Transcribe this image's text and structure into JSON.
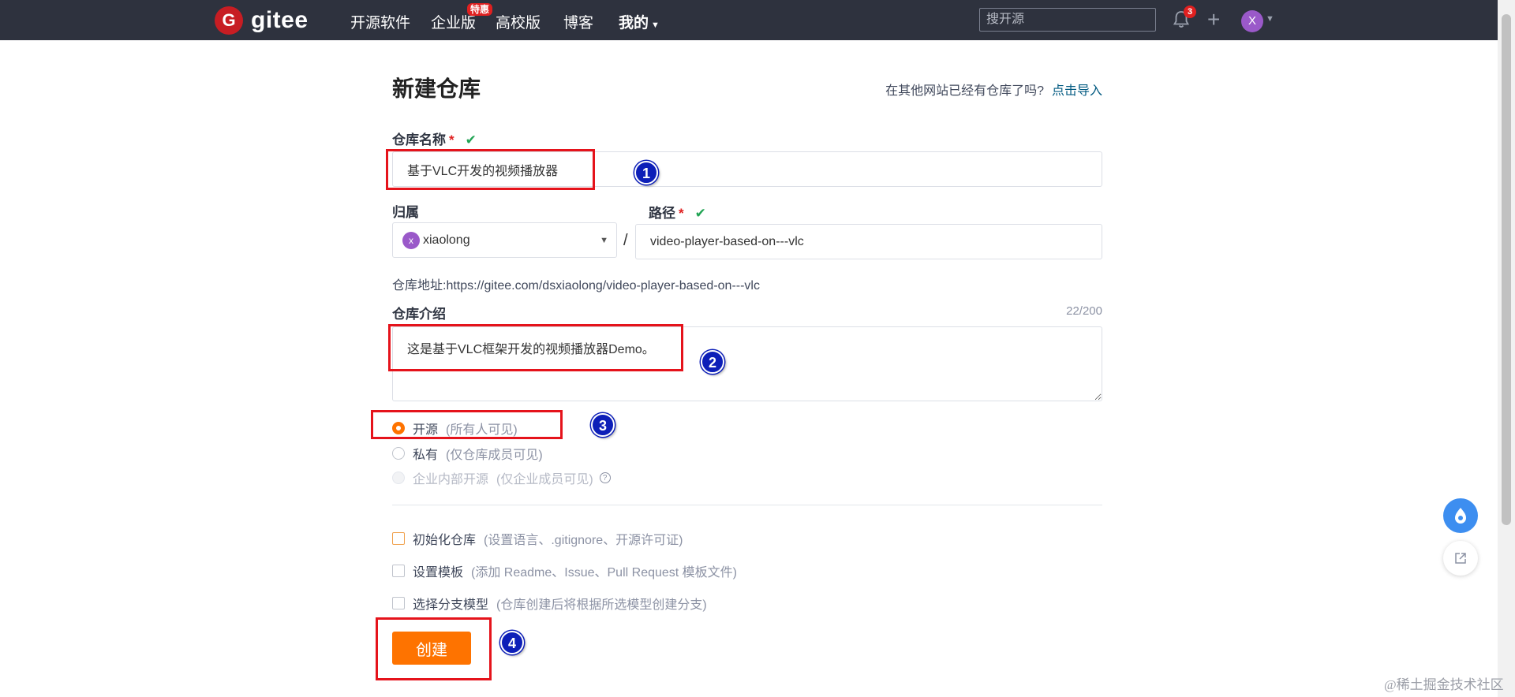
{
  "nav": {
    "logo_mark": "G",
    "logo_text": "gitee",
    "items": [
      "开源软件",
      "企业版",
      "高校版",
      "博客",
      "我的"
    ],
    "enterprise_badge": "特惠",
    "search_placeholder": "搜开源",
    "notification_count": "3",
    "avatar_letter": "X"
  },
  "form": {
    "title": "新建仓库",
    "import_prompt": "在其他网站已经有仓库了吗?",
    "import_link": "点击导入",
    "repo_name_label": "仓库名称",
    "required_mark": "*",
    "repo_name_value": "基于VLC开发的视频播放器",
    "owner_label": "归属",
    "owner_avatar": "x",
    "owner_value": "xiaolong",
    "path_separator": "/",
    "path_label": "路径",
    "path_value": "video-player-based-on---vlc",
    "address_label": "仓库地址:",
    "address_value": "https://gitee.com/dsxiaolong/video-player-based-on---vlc",
    "desc_label": "仓库介绍",
    "desc_counter": "22/200",
    "desc_value": "这是基于VLC框架开发的视频播放器Demo。",
    "visibility": [
      {
        "label": "开源",
        "hint": "(所有人可见)",
        "state": "selected"
      },
      {
        "label": "私有",
        "hint": "(仅仓库成员可见)",
        "state": "unselected"
      },
      {
        "label": "企业内部开源",
        "hint": "(仅企业成员可见)",
        "state": "disabled"
      }
    ],
    "options": [
      {
        "label": "初始化仓库",
        "hint": "(设置语言、.gitignore、开源许可证)"
      },
      {
        "label": "设置模板",
        "hint": "(添加 Readme、Issue、Pull Request 模板文件)"
      },
      {
        "label": "选择分支模型",
        "hint": "(仓库创建后将根据所选模型创建分支)"
      }
    ],
    "create_button": "创建"
  },
  "annotations": [
    "1",
    "2",
    "3",
    "4"
  ],
  "watermark": "@稀土掘金技术社区",
  "colors": {
    "nav_bg": "#2e323e",
    "accent_orange": "#fe7300",
    "brand_red": "#c71d23",
    "annotation_red": "#e5131b",
    "annotation_blue": "#0d1fb8",
    "check_green": "#21a454"
  }
}
